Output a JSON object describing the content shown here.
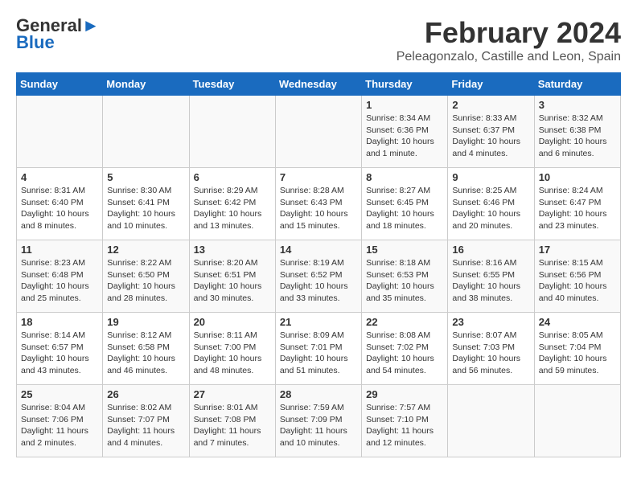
{
  "header": {
    "logo_line1": "General",
    "logo_line2": "Blue",
    "title": "February 2024",
    "subtitle": "Peleagonzalo, Castille and Leon, Spain"
  },
  "calendar": {
    "weekdays": [
      "Sunday",
      "Monday",
      "Tuesday",
      "Wednesday",
      "Thursday",
      "Friday",
      "Saturday"
    ],
    "weeks": [
      [
        {
          "day": "",
          "info": ""
        },
        {
          "day": "",
          "info": ""
        },
        {
          "day": "",
          "info": ""
        },
        {
          "day": "",
          "info": ""
        },
        {
          "day": "1",
          "info": "Sunrise: 8:34 AM\nSunset: 6:36 PM\nDaylight: 10 hours and 1 minute."
        },
        {
          "day": "2",
          "info": "Sunrise: 8:33 AM\nSunset: 6:37 PM\nDaylight: 10 hours and 4 minutes."
        },
        {
          "day": "3",
          "info": "Sunrise: 8:32 AM\nSunset: 6:38 PM\nDaylight: 10 hours and 6 minutes."
        }
      ],
      [
        {
          "day": "4",
          "info": "Sunrise: 8:31 AM\nSunset: 6:40 PM\nDaylight: 10 hours and 8 minutes."
        },
        {
          "day": "5",
          "info": "Sunrise: 8:30 AM\nSunset: 6:41 PM\nDaylight: 10 hours and 10 minutes."
        },
        {
          "day": "6",
          "info": "Sunrise: 8:29 AM\nSunset: 6:42 PM\nDaylight: 10 hours and 13 minutes."
        },
        {
          "day": "7",
          "info": "Sunrise: 8:28 AM\nSunset: 6:43 PM\nDaylight: 10 hours and 15 minutes."
        },
        {
          "day": "8",
          "info": "Sunrise: 8:27 AM\nSunset: 6:45 PM\nDaylight: 10 hours and 18 minutes."
        },
        {
          "day": "9",
          "info": "Sunrise: 8:25 AM\nSunset: 6:46 PM\nDaylight: 10 hours and 20 minutes."
        },
        {
          "day": "10",
          "info": "Sunrise: 8:24 AM\nSunset: 6:47 PM\nDaylight: 10 hours and 23 minutes."
        }
      ],
      [
        {
          "day": "11",
          "info": "Sunrise: 8:23 AM\nSunset: 6:48 PM\nDaylight: 10 hours and 25 minutes."
        },
        {
          "day": "12",
          "info": "Sunrise: 8:22 AM\nSunset: 6:50 PM\nDaylight: 10 hours and 28 minutes."
        },
        {
          "day": "13",
          "info": "Sunrise: 8:20 AM\nSunset: 6:51 PM\nDaylight: 10 hours and 30 minutes."
        },
        {
          "day": "14",
          "info": "Sunrise: 8:19 AM\nSunset: 6:52 PM\nDaylight: 10 hours and 33 minutes."
        },
        {
          "day": "15",
          "info": "Sunrise: 8:18 AM\nSunset: 6:53 PM\nDaylight: 10 hours and 35 minutes."
        },
        {
          "day": "16",
          "info": "Sunrise: 8:16 AM\nSunset: 6:55 PM\nDaylight: 10 hours and 38 minutes."
        },
        {
          "day": "17",
          "info": "Sunrise: 8:15 AM\nSunset: 6:56 PM\nDaylight: 10 hours and 40 minutes."
        }
      ],
      [
        {
          "day": "18",
          "info": "Sunrise: 8:14 AM\nSunset: 6:57 PM\nDaylight: 10 hours and 43 minutes."
        },
        {
          "day": "19",
          "info": "Sunrise: 8:12 AM\nSunset: 6:58 PM\nDaylight: 10 hours and 46 minutes."
        },
        {
          "day": "20",
          "info": "Sunrise: 8:11 AM\nSunset: 7:00 PM\nDaylight: 10 hours and 48 minutes."
        },
        {
          "day": "21",
          "info": "Sunrise: 8:09 AM\nSunset: 7:01 PM\nDaylight: 10 hours and 51 minutes."
        },
        {
          "day": "22",
          "info": "Sunrise: 8:08 AM\nSunset: 7:02 PM\nDaylight: 10 hours and 54 minutes."
        },
        {
          "day": "23",
          "info": "Sunrise: 8:07 AM\nSunset: 7:03 PM\nDaylight: 10 hours and 56 minutes."
        },
        {
          "day": "24",
          "info": "Sunrise: 8:05 AM\nSunset: 7:04 PM\nDaylight: 10 hours and 59 minutes."
        }
      ],
      [
        {
          "day": "25",
          "info": "Sunrise: 8:04 AM\nSunset: 7:06 PM\nDaylight: 11 hours and 2 minutes."
        },
        {
          "day": "26",
          "info": "Sunrise: 8:02 AM\nSunset: 7:07 PM\nDaylight: 11 hours and 4 minutes."
        },
        {
          "day": "27",
          "info": "Sunrise: 8:01 AM\nSunset: 7:08 PM\nDaylight: 11 hours and 7 minutes."
        },
        {
          "day": "28",
          "info": "Sunrise: 7:59 AM\nSunset: 7:09 PM\nDaylight: 11 hours and 10 minutes."
        },
        {
          "day": "29",
          "info": "Sunrise: 7:57 AM\nSunset: 7:10 PM\nDaylight: 11 hours and 12 minutes."
        },
        {
          "day": "",
          "info": ""
        },
        {
          "day": "",
          "info": ""
        }
      ]
    ]
  }
}
